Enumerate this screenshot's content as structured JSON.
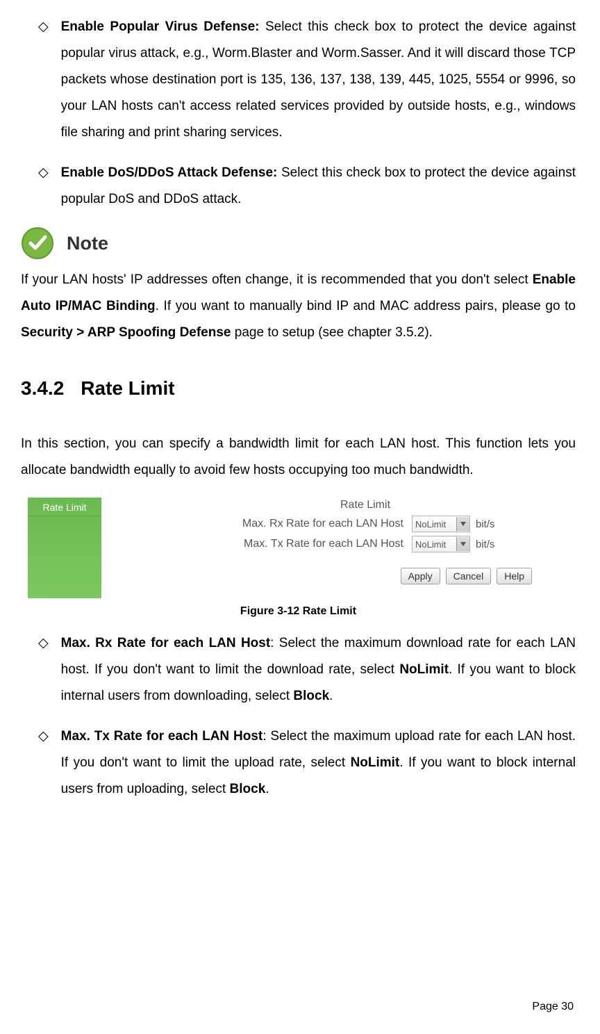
{
  "bullet1": {
    "term": "Enable Popular Virus Defense:",
    "desc": " Select this check box to protect the device against popular virus attack, e.g., Worm.Blaster and Worm.Sasser. And it will discard those TCP packets whose destination port is 135, 136, 137, 138, 139, 445, 1025, 5554 or 9996, so your LAN hosts can't access related services provided by outside hosts, e.g., windows file sharing and print sharing services."
  },
  "bullet2": {
    "term": "Enable DoS/DDoS Attack Defense:",
    "desc": " Select this check box to protect the device against popular DoS and DDoS attack."
  },
  "note": {
    "label": "Note",
    "p_pre": "If your LAN hosts' IP addresses often change, it is recommended that you don't select ",
    "b1": "Enable Auto IP/MAC Binding",
    "mid": ". If you want to manually bind IP and MAC address pairs, please go to ",
    "b2": "Security > ARP Spoofing Defense",
    "post": " page to setup (see chapter 3.5.2)."
  },
  "section": {
    "num": "3.4.2",
    "title": "Rate Limit",
    "intro": "In this section, you can specify a bandwidth limit for each LAN host. This function lets you allocate bandwidth equally to avoid few hosts occupying too much bandwidth."
  },
  "figure": {
    "tab": "Rate Limit",
    "panel_title": "Rate Limit",
    "row1_label": "Max. Rx Rate for each LAN Host",
    "row2_label": "Max. Tx Rate for each LAN Host",
    "select_value": "NoLimit",
    "unit": "bit/s",
    "btn_apply": "Apply",
    "btn_cancel": "Cancel",
    "btn_help": "Help",
    "caption": "Figure 3-12 Rate Limit"
  },
  "bullet3": {
    "term": "Max. Rx Rate for each LAN Host",
    "d1": ": Select the maximum download rate for each LAN host. If you don't want to limit the download rate, select ",
    "b1": "NoLimit",
    "d2": ". If you want to block internal users from downloading, select ",
    "b2": "Block",
    "d3": "."
  },
  "bullet4": {
    "term": "Max. Tx Rate for each LAN Host",
    "d1": ": Select the maximum upload rate for each LAN host. If you don't want to limit the upload rate, select ",
    "b1": "NoLimit",
    "d2": ". If you want to block internal users from uploading, select ",
    "b2": "Block",
    "d3": "."
  },
  "pagenum": "Page 30"
}
